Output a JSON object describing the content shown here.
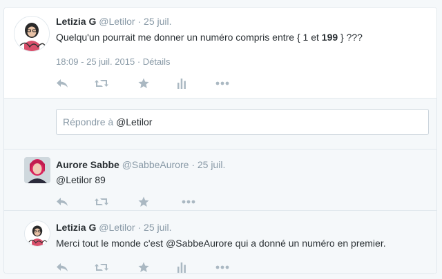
{
  "main_tweet": {
    "name": "Letizia G",
    "handle": "@Letilor",
    "date": "· 25 juil.",
    "text_before": "Quelqu'un pourrait me donner un numéro compris entre { 1 et ",
    "text_bold": "199",
    "text_after": " } ???",
    "timestamp": "18:09 - 25 juil. 2015",
    "details_sep": " · ",
    "details_label": "Détails"
  },
  "reply_box": {
    "prefix": "Répondre à ",
    "mention": "@Letilor"
  },
  "reply_tweet": {
    "name": "Aurore Sabbe",
    "handle": "@SabbeAurore",
    "date": "· 25 juil.",
    "text": "@Letilor 89"
  },
  "last_tweet": {
    "name": "Letizia G",
    "handle": "@Letilor",
    "date": "· 25 juil.",
    "text": "Merci tout le monde c'est @SabbeAurore qui a donné un numéro en premier."
  },
  "icons": [
    "reply-icon",
    "retweet-icon",
    "favorite-icon",
    "analytics-icon",
    "more-icon"
  ],
  "colors": {
    "icon": "#aab8c2",
    "muted": "#8899a6",
    "text": "#292f33",
    "bg": "#f5f8fa"
  }
}
